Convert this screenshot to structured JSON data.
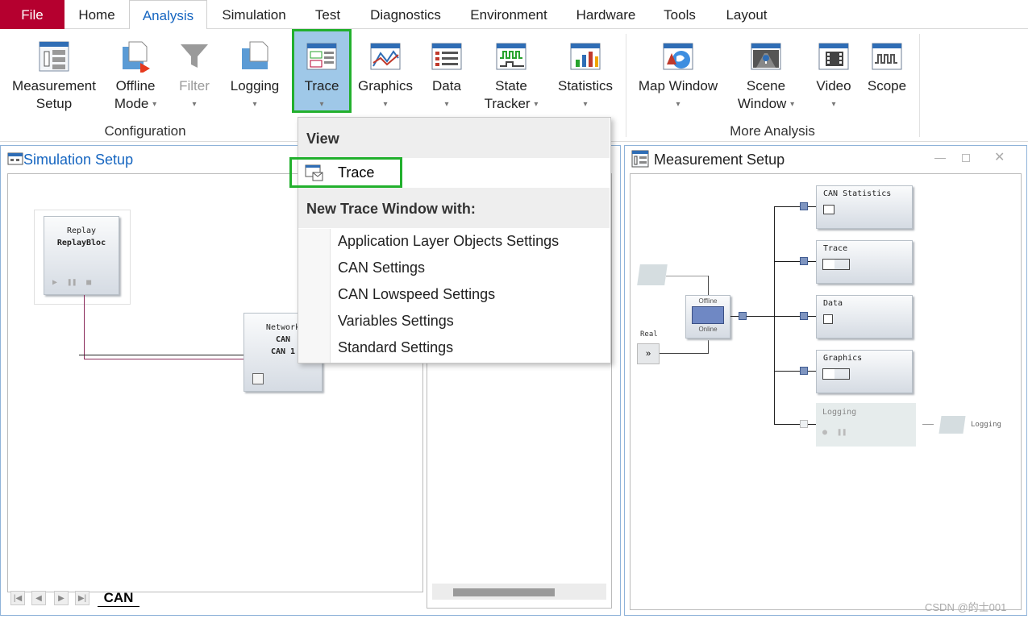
{
  "menu": {
    "tabs": [
      "File",
      "Home",
      "Analysis",
      "Simulation",
      "Test",
      "Diagnostics",
      "Environment",
      "Hardware",
      "Tools",
      "Layout"
    ],
    "active": "Analysis"
  },
  "ribbon": {
    "measurement_setup": [
      "Measurement",
      "Setup"
    ],
    "offline_mode": [
      "Offline",
      "Mode"
    ],
    "filter": "Filter",
    "logging": "Logging",
    "trace": "Trace",
    "graphics": "Graphics",
    "data": "Data",
    "state_tracker": [
      "State",
      "Tracker"
    ],
    "statistics": "Statistics",
    "map_window": "Map Window",
    "scene_window": [
      "Scene",
      "Window"
    ],
    "video": "Video",
    "scope": "Scope",
    "group_configuration": "Configuration",
    "group_more_analysis": "More Analysis"
  },
  "simulation_window": {
    "title": "Simulation Setup",
    "replay_block": {
      "title": "Replay",
      "name": "ReplayBloc"
    },
    "network_block": {
      "title": "Network",
      "line1": "CAN",
      "line2": "CAN 1"
    },
    "sheet_tab": "CAN"
  },
  "measurement_window": {
    "title": "Measurement Setup",
    "blocks": [
      "CAN Statistics",
      "Trace",
      "Data",
      "Graphics",
      "Logging"
    ],
    "logging_out": "Logging",
    "offline": "Offline",
    "online": "Online",
    "real": "Real"
  },
  "dropdown": {
    "view_header": "View",
    "trace_item": "Trace",
    "new_header": "New Trace Window with:",
    "items": [
      "Application Layer Objects Settings",
      "CAN Settings",
      "CAN Lowspeed Settings",
      "Variables Settings",
      "Standard Settings"
    ]
  },
  "watermark": "CSDN @的士001",
  "colors": {
    "file_tab": "#b5002f",
    "accent": "#1565c0",
    "highlight": "#22b02d"
  }
}
